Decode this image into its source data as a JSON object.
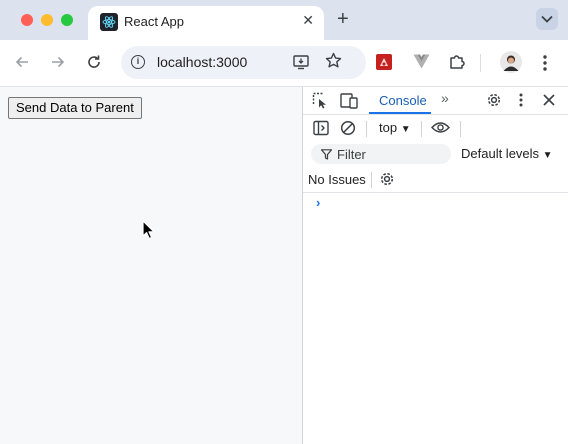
{
  "browser": {
    "tab": {
      "title": "React App",
      "close_label": "✕"
    },
    "new_tab_label": "+",
    "address": {
      "url": "localhost:3000"
    }
  },
  "page": {
    "button_label": "Send Data to Parent"
  },
  "devtools": {
    "active_tab": "Console",
    "more_tabs_label": "»",
    "context": "top",
    "filter_placeholder": "Filter",
    "levels": "Default levels",
    "issues": "No Issues",
    "prompt": "›"
  },
  "colors": {
    "accent": "#1a73e8",
    "tab_strip": "#dde3ee",
    "page_bg": "#f7f8fa"
  }
}
